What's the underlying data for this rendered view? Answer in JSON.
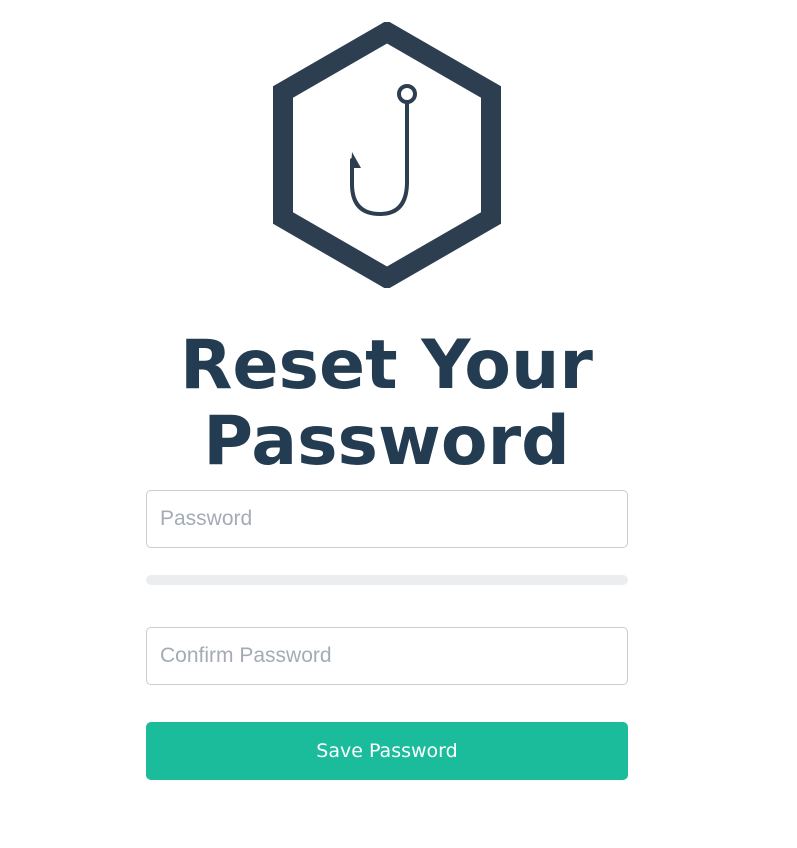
{
  "logo": {
    "icon": "fishhook-hexagon-icon",
    "color": "#2c3e50"
  },
  "title": {
    "line1": "Reset Your",
    "line2": "Password"
  },
  "form": {
    "password_placeholder": "Password",
    "password_value": "",
    "strength_level": 0,
    "confirm_placeholder": "Confirm Password",
    "confirm_value": "",
    "submit_label": "Save Password"
  },
  "colors": {
    "accent": "#1abc9c",
    "heading": "#2c3e50",
    "track": "#ebedef"
  }
}
